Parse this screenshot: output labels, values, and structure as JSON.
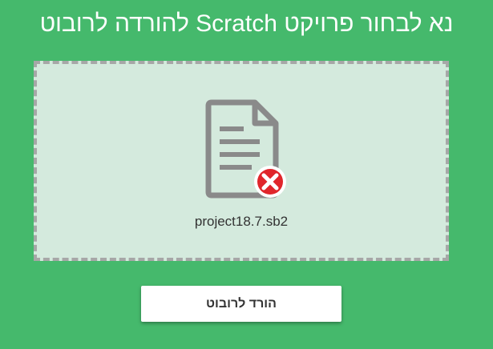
{
  "header": {
    "title": "נא לבחור פרויקט Scratch להורדה לרובוט"
  },
  "drop_zone": {
    "file_icon": "document-icon",
    "status_icon": "error-x-icon",
    "file_name": "project18.7.sb2"
  },
  "actions": {
    "download_label": "הורד לרובוט"
  },
  "colors": {
    "background": "#45b96c",
    "drop_zone_background": "#d4eadd",
    "drop_zone_border": "#a7a7a7",
    "icon_gray": "#8a8a8a",
    "error_red": "#e0262b",
    "button_background": "#ffffff"
  }
}
